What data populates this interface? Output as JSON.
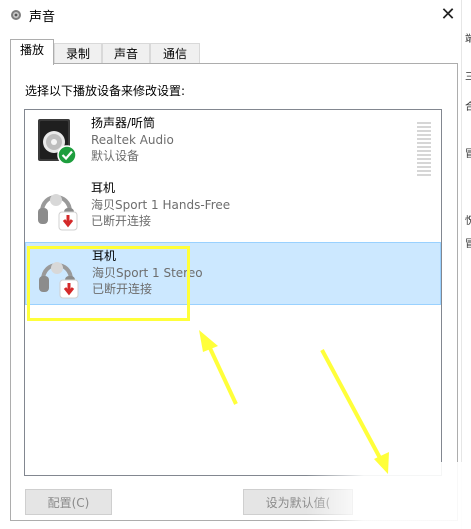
{
  "window": {
    "title": "声音",
    "close_symbol": "✕"
  },
  "tabs": [
    {
      "label": "播放",
      "active": true
    },
    {
      "label": "录制",
      "active": false
    },
    {
      "label": "声音",
      "active": false
    },
    {
      "label": "通信",
      "active": false
    }
  ],
  "instruction": "选择以下播放设备来修改设置:",
  "devices": [
    {
      "name": "扬声器/听筒",
      "line2": "Realtek Audio",
      "line3": "默认设备",
      "status": "default",
      "icon": "speaker-icon",
      "selected": false
    },
    {
      "name": "耳机",
      "line2": "海贝Sport 1 Hands-Free",
      "line3": "已断开连接",
      "status": "disconnected",
      "icon": "headphones-icon",
      "selected": false
    },
    {
      "name": "耳机",
      "line2": "海贝Sport 1 Stereo",
      "line3": "已断开连接",
      "status": "disconnected",
      "icon": "headphones-icon",
      "selected": true
    }
  ],
  "buttons": {
    "configure": "配置(C)",
    "set_default": "设为默认值("
  },
  "right_edge_glyphs": [
    "端",
    "三",
    "合",
    "冒",
    "怳",
    "冒"
  ],
  "colors": {
    "selection": "#cce8ff",
    "annotation": "#ffff3a",
    "check": "#1e9e3e",
    "disconnect": "#d42a2a"
  }
}
